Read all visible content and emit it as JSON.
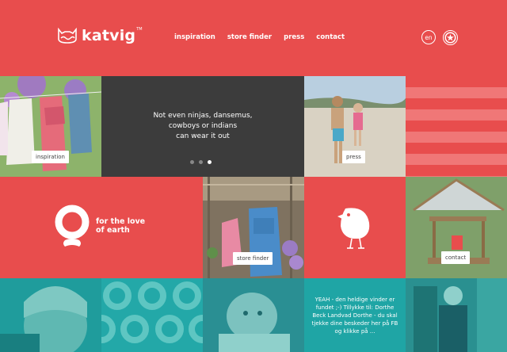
{
  "header": {
    "logo_text": "katvig",
    "logo_tm": "TM",
    "nav": [
      "inspiration",
      "store finder",
      "press",
      "contact"
    ],
    "lang": "en"
  },
  "tiles": {
    "inspiration_label": "inspiration",
    "slider_text": [
      "Not even ninjas, dansemus,",
      "cowboys or indians",
      "can wear it out"
    ],
    "press_label": "press",
    "love_text": [
      "for the love",
      "of earth"
    ],
    "store_label": "store finder",
    "contact_label": "contact",
    "fb_text": "YEAH - den heldige vinder er fundet ;-) Tillykke til: Dorthe Beck Landvad Dorthe - du skal tjekke dine beskeder her på FB og klikke på ..."
  },
  "colors": {
    "brand_red": "#e84d4d",
    "slider_dark": "#3c3c3c",
    "teal": "#1f9c9c"
  },
  "icons": [
    "cat-logo-icon",
    "star-badge-icon",
    "earth-ring-icon",
    "bird-icon"
  ],
  "slider": {
    "slides": 3,
    "active_index": 3
  }
}
